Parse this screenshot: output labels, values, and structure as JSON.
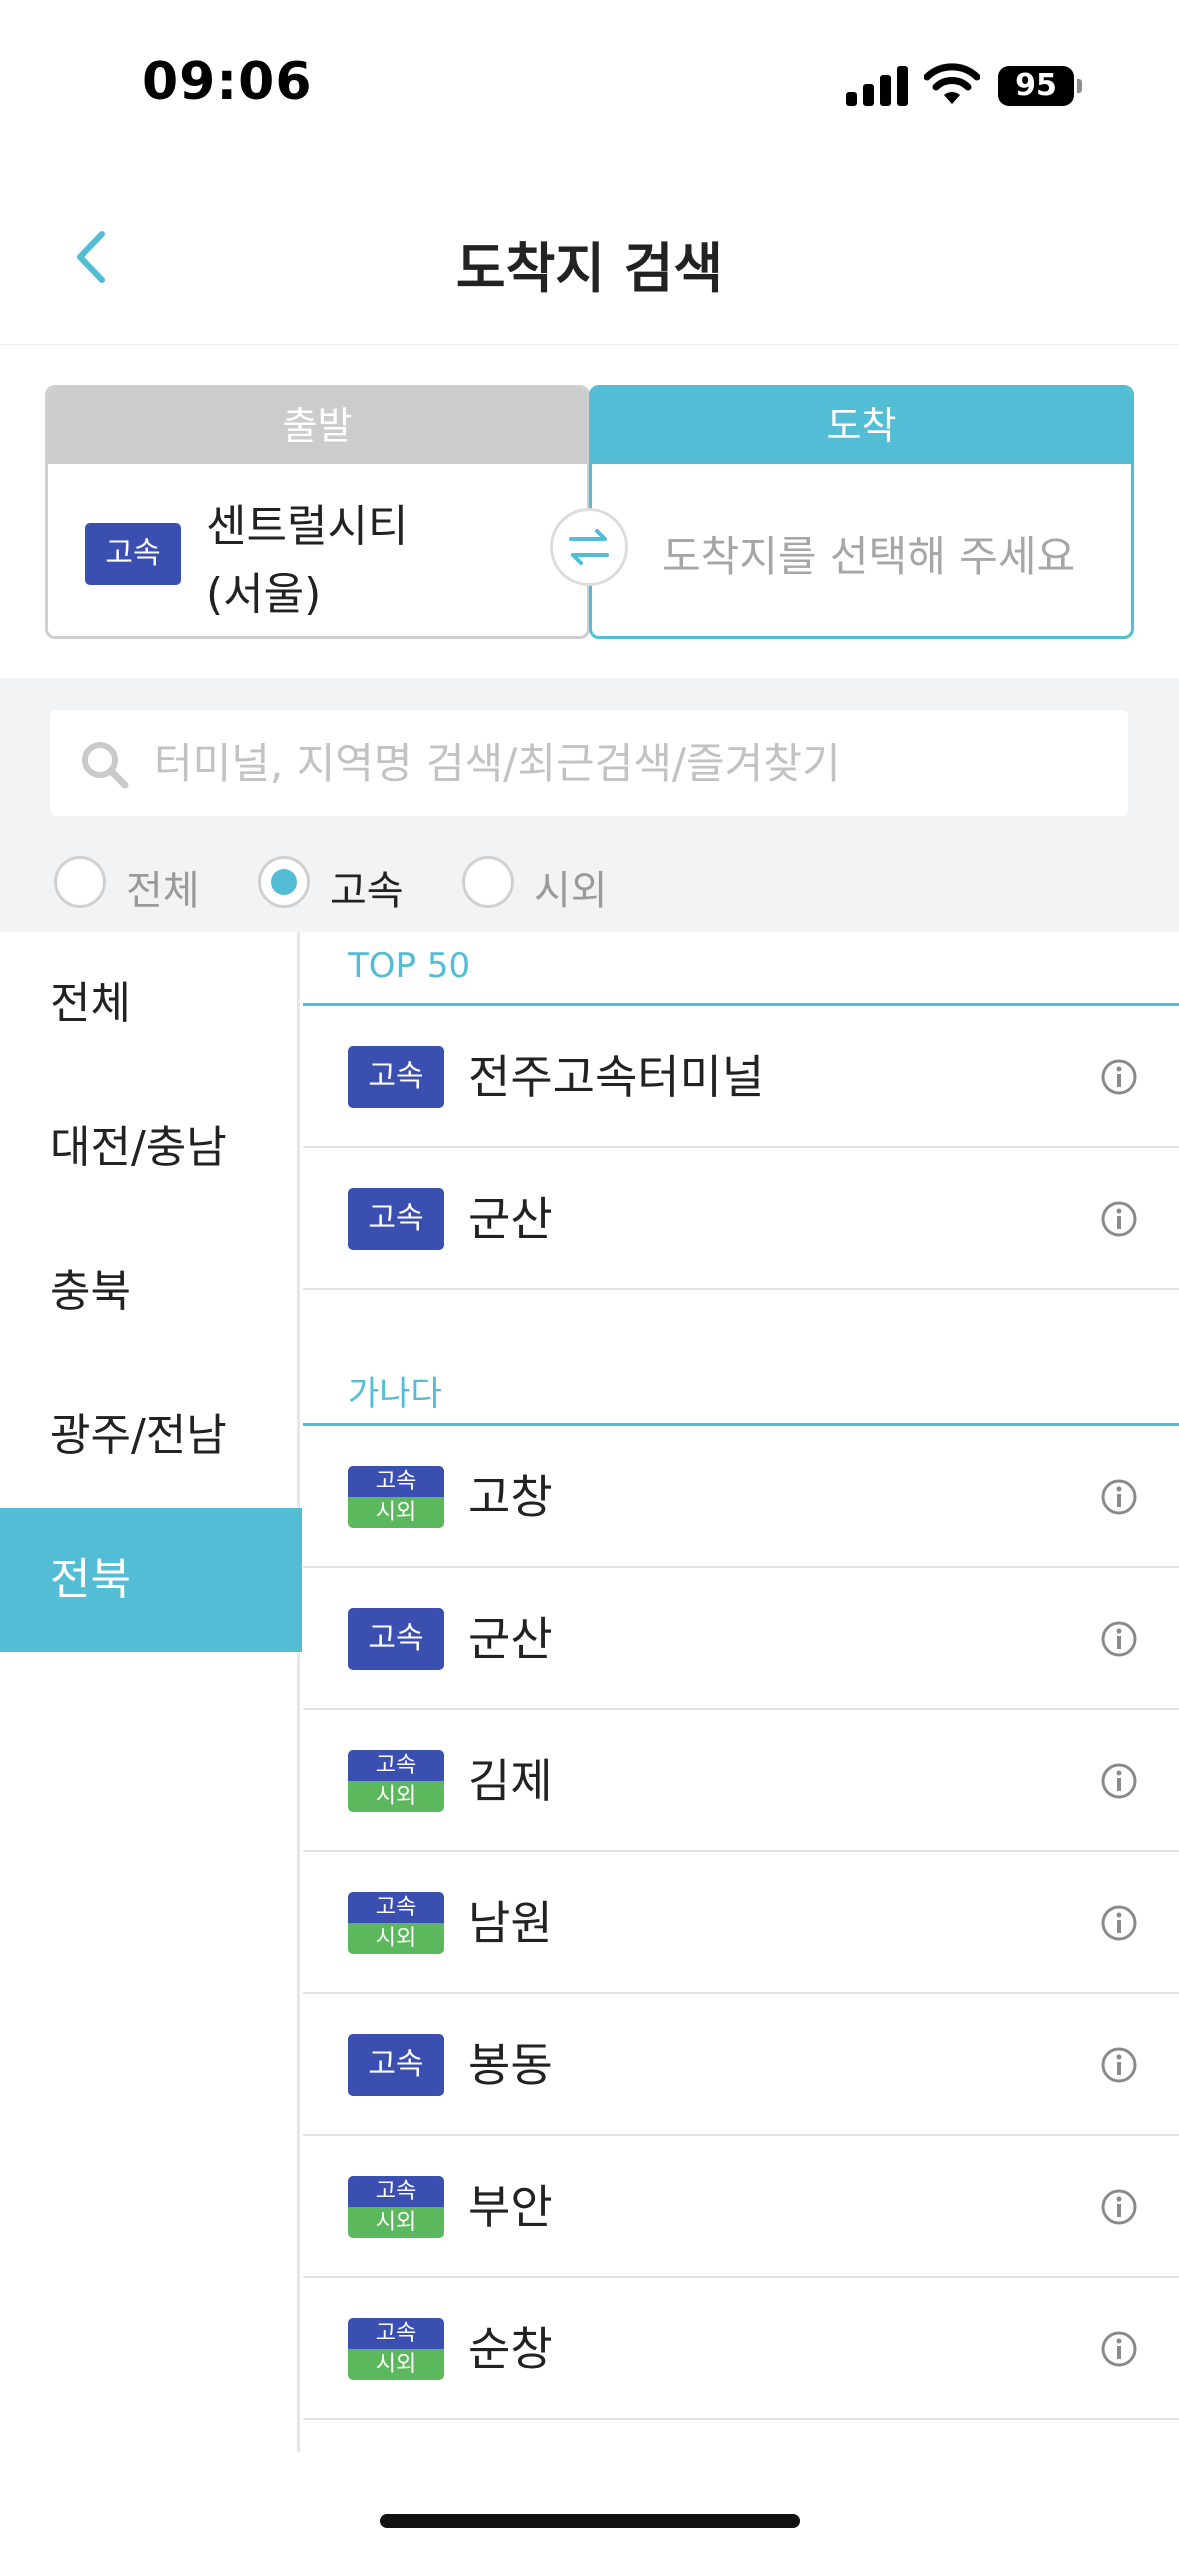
{
  "status": {
    "time": "09:06",
    "battery": "95"
  },
  "header": {
    "title": "도착지 검색"
  },
  "route": {
    "depart_label": "출발",
    "arrive_label": "도착",
    "depart_badge": "고속",
    "depart_name": "센트럴시티\n(서울)",
    "arrive_placeholder": "도착지를 선택해 주세요"
  },
  "search": {
    "placeholder": "터미널, 지역명 검색/최근검색/즐겨찾기"
  },
  "filters": {
    "options": [
      "전체",
      "고속",
      "시외"
    ],
    "selected": "고속"
  },
  "regions": {
    "items": [
      "전체",
      "대전/충남",
      "충북",
      "광주/전남",
      "전북"
    ],
    "selected": "전북"
  },
  "badges": {
    "express": "고속",
    "intercity": "시외"
  },
  "sections": {
    "top50": {
      "title": "TOP 50",
      "items": [
        {
          "type": "express",
          "name": "전주고속터미널"
        },
        {
          "type": "express",
          "name": "군산"
        }
      ]
    },
    "alpha": {
      "title": "가나다",
      "items": [
        {
          "type": "dual",
          "name": "고창"
        },
        {
          "type": "express",
          "name": "군산"
        },
        {
          "type": "dual",
          "name": "김제"
        },
        {
          "type": "dual",
          "name": "남원"
        },
        {
          "type": "express",
          "name": "봉동"
        },
        {
          "type": "dual",
          "name": "부안"
        },
        {
          "type": "dual",
          "name": "순창"
        }
      ]
    }
  },
  "colors": {
    "accent": "#52bdd4",
    "express_badge": "#3b4fb0",
    "intercity_badge": "#5cb85c"
  }
}
